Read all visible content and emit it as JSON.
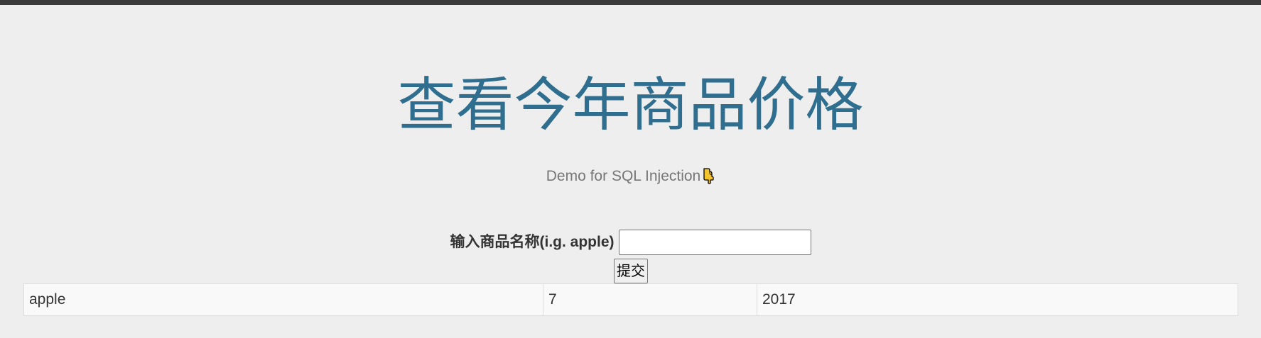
{
  "header": {
    "title": "查看今年商品价格",
    "subtitle": "Demo for SQL Injection",
    "subtitle_icon": "pointing-down-hand-icon"
  },
  "search": {
    "label": "输入商品名称(i.g. apple)",
    "value": "",
    "placeholder": "",
    "submit_label": "提交"
  },
  "results": {
    "rows": [
      {
        "name": "apple",
        "price": "7",
        "year": "2017"
      }
    ]
  },
  "colors": {
    "top_bar": "#3a3a3a",
    "background": "#eeeeee",
    "title": "#2f6e8e",
    "subtitle": "#777777",
    "hand_icon_fill": "#f4c430"
  }
}
